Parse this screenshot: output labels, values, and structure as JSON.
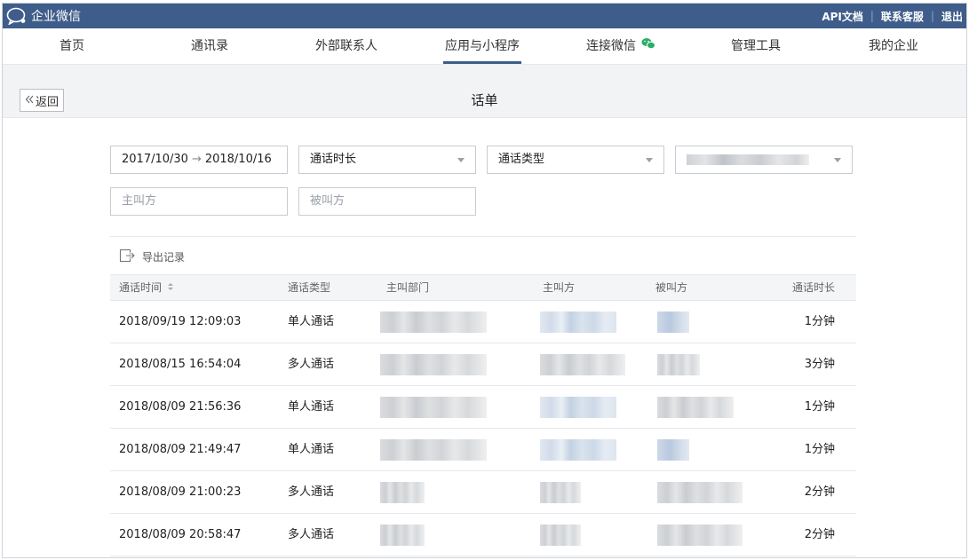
{
  "topbar": {
    "app_name": "企业微信",
    "links": [
      "API文档",
      "联系客服",
      "退出"
    ]
  },
  "nav": {
    "items": [
      "首页",
      "通讯录",
      "外部联系人",
      "应用与小程序",
      "连接微信",
      "管理工具",
      "我的企业"
    ],
    "active": "应用与小程序"
  },
  "subheader": {
    "back_label": "返回",
    "title": "话单"
  },
  "filters": {
    "date_start": "2017/10/30",
    "date_end": "2018/10/16",
    "duration_select": "通话时长",
    "type_select": "通话类型",
    "caller_placeholder": "主叫方",
    "callee_placeholder": "被叫方"
  },
  "toolbar": {
    "export_label": "导出记录"
  },
  "table": {
    "headers": {
      "time": "通话时间",
      "type": "通话类型",
      "dept": "主叫部门",
      "caller": "主叫方",
      "callee": "被叫方",
      "duration": "通话时长"
    },
    "rows": [
      {
        "time": "2018/09/19 12:09:03",
        "type": "单人通话",
        "duration": "1分钟"
      },
      {
        "time": "2018/08/15 16:54:04",
        "type": "多人通话",
        "duration": "3分钟"
      },
      {
        "time": "2018/08/09 21:56:36",
        "type": "单人通话",
        "duration": "1分钟"
      },
      {
        "time": "2018/08/09 21:49:47",
        "type": "单人通话",
        "duration": "1分钟"
      },
      {
        "time": "2018/08/09 21:00:23",
        "type": "多人通话",
        "duration": "2分钟"
      },
      {
        "time": "2018/08/09 20:58:47",
        "type": "多人通话",
        "duration": "2分钟"
      }
    ]
  },
  "colors": {
    "topbar": "#3f5d8a",
    "nav_active": "#3f5d8a",
    "subheader_bg": "#f2f3f5",
    "wechat_green": "#2aae67"
  },
  "icons": {
    "logo": "chat-bubble-icon",
    "back": "double-chevron-left-icon",
    "date_arrow": "arrow-right-icon",
    "dropdown": "caret-down-icon",
    "export": "export-icon",
    "sort": "sort-icon",
    "wechat": "wechat-icon"
  }
}
